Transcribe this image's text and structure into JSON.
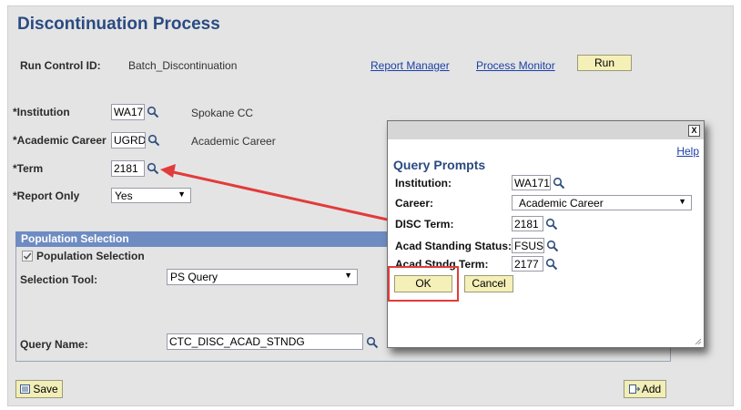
{
  "page": {
    "title": "Discontinuation Process",
    "run_control_label": "Run Control ID:",
    "run_control_value": "Batch_Discontinuation",
    "report_manager": "Report Manager",
    "process_monitor": "Process Monitor",
    "run_button": "Run"
  },
  "form": {
    "institution_label": "*Institution",
    "institution_value": "WA171",
    "institution_desc": "Spokane CC",
    "career_label": "*Academic Career",
    "career_value": "UGRD",
    "career_desc": "Academic Career",
    "term_label": "*Term",
    "term_value": "2181",
    "report_only_label": "*Report Only",
    "report_only_value": "Yes"
  },
  "population": {
    "header": "Population Selection",
    "checkbox_label": "Population Selection",
    "checkbox_checked": true,
    "tool_label": "Selection Tool:",
    "tool_value": "PS Query",
    "query_label": "Query Name:",
    "query_value": "CTC_DISC_ACAD_STNDG"
  },
  "footer": {
    "save": "Save",
    "add": "Add"
  },
  "dialog": {
    "close": "X",
    "help": "Help",
    "title": "Query Prompts",
    "institution_label": "Institution:",
    "institution_value": "WA171",
    "career_label": "Career:",
    "career_value": "Academic Career",
    "disc_term_label": "DISC Term:",
    "disc_term_value": "2181",
    "acad_status_label": "Acad Standing Status:",
    "acad_status_value": "FSUS",
    "acad_term_label": "Acad Stndg Term:",
    "acad_term_value": "2177",
    "ok": "OK",
    "cancel": "Cancel"
  },
  "colors": {
    "title": "#2a4a82",
    "link": "#1a3fa8",
    "button": "#f5f0b8",
    "group_header": "#6e8cc2",
    "annotation": "#e23b3b"
  },
  "icons": {
    "lookup": "magnifier-icon",
    "save": "save-icon",
    "add": "add-icon",
    "close": "close-icon"
  }
}
